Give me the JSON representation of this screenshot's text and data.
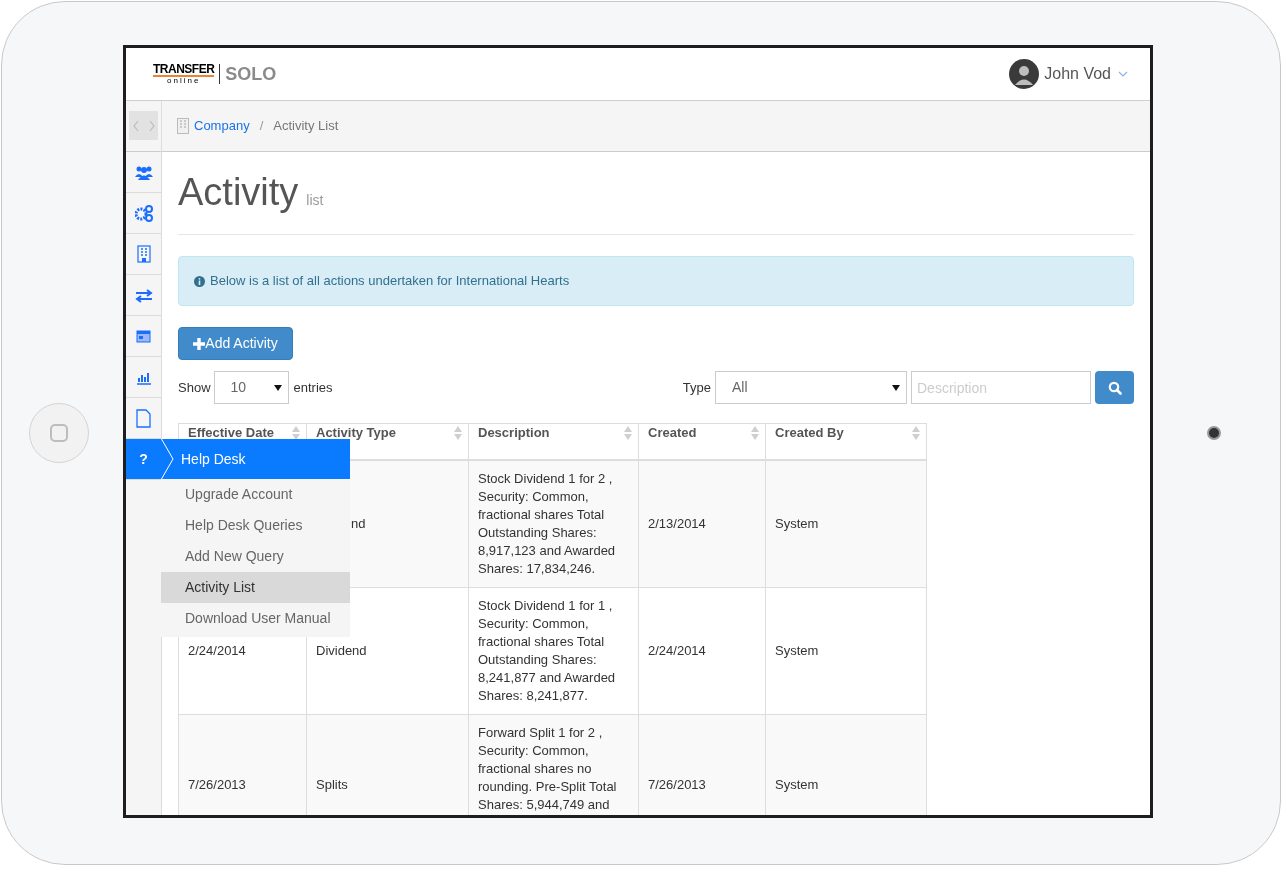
{
  "logo": {
    "brand": "TRANSFER",
    "sub": "online",
    "product": "SOLO"
  },
  "user": {
    "name": "John Vod"
  },
  "sidebar": {
    "items": [
      {
        "kind": "users",
        "selected": false
      },
      {
        "kind": "cogs",
        "selected": false
      },
      {
        "kind": "building",
        "selected": false
      },
      {
        "kind": "transfer",
        "selected": false
      },
      {
        "kind": "card",
        "selected": false
      },
      {
        "kind": "chart",
        "selected": false
      },
      {
        "kind": "file",
        "selected": false
      },
      {
        "kind": "help",
        "label": "?",
        "selected": true
      }
    ]
  },
  "flyout": {
    "title": "Help Desk",
    "items": [
      {
        "label": "Upgrade Account",
        "selected": false
      },
      {
        "label": "Help Desk Queries",
        "selected": false
      },
      {
        "label": "Add New Query",
        "selected": false
      },
      {
        "label": "Activity List",
        "selected": true
      },
      {
        "label": "Download User Manual",
        "selected": false
      }
    ]
  },
  "breadcrumb": {
    "items": [
      {
        "label": "Company",
        "link": true
      },
      {
        "label": "Activity List",
        "link": false
      }
    ],
    "separator": "/"
  },
  "page": {
    "title": "Activity",
    "subtitle": "list"
  },
  "alert": {
    "text": "Below is a list of all actions undertaken for International Hearts"
  },
  "add_button": {
    "label": "Add Activity"
  },
  "length": {
    "label_before": "Show",
    "value": "10",
    "label_after": "entries"
  },
  "filter": {
    "label": "Type",
    "value": "All",
    "placeholder": "Description"
  },
  "table": {
    "columns": [
      "Effective Date",
      "Activity Type",
      "Description",
      "Created",
      "Created By"
    ],
    "rows": [
      {
        "activity_type": "nd",
        "type_partly_hidden": true,
        "description": "Stock Dividend 1 for 2 , Security: Common, fractional shares Total Outstanding Shares: 8,917,123 and Awarded Shares: 17,834,246.",
        "created": "2/13/2014",
        "created_by": "System"
      },
      {
        "effective_date": "2/24/2014",
        "activity_type": "Dividend",
        "type_partly_hidden": false,
        "description": "Stock Dividend 1 for 1 , Security: Common, fractional shares Total Outstanding Shares: 8,241,877 and Awarded Shares: 8,241,877.",
        "created": "2/24/2014",
        "created_by": "System"
      },
      {
        "effective_date": "7/26/2013",
        "activity_type": "Splits",
        "type_partly_hidden": false,
        "description": "Forward Split 1 for 2 , Security: Common, fractional shares no rounding. Pre-Split Total Shares: 5,944,749 and",
        "created": "7/26/2013",
        "created_by": "System"
      }
    ]
  }
}
